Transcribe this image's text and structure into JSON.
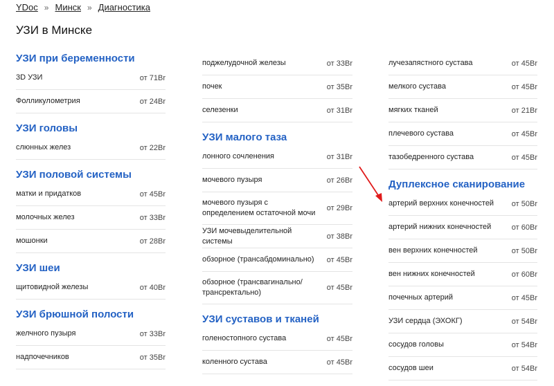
{
  "breadcrumb": {
    "items": [
      "YDoc",
      "Минск",
      "Диагностика"
    ],
    "separator": "»"
  },
  "page_title": "УЗИ в Минске",
  "columns": [
    {
      "blocks": [
        {
          "type": "header",
          "text": "УЗИ при беременности",
          "h": 24,
          "gap_before": 0
        },
        {
          "type": "row",
          "name": "3D УЗИ",
          "price": "от 71Br",
          "h": 34
        },
        {
          "type": "row",
          "name": "Фолликулометрия",
          "price": "от 24Br",
          "h": 34
        },
        {
          "type": "header",
          "text": "УЗИ головы",
          "h": 24,
          "gap_before": 9
        },
        {
          "type": "row",
          "name": "слюнных желез",
          "price": "от 22Br",
          "h": 34
        },
        {
          "type": "header",
          "text": "УЗИ половой системы",
          "h": 24,
          "gap_before": 9
        },
        {
          "type": "row",
          "name": "матки и придатков",
          "price": "от 45Br",
          "h": 34
        },
        {
          "type": "row",
          "name": "молочных желез",
          "price": "от 33Br",
          "h": 34
        },
        {
          "type": "row",
          "name": "мошонки",
          "price": "от 28Br",
          "h": 34
        },
        {
          "type": "header",
          "text": "УЗИ шеи",
          "h": 24,
          "gap_before": 9
        },
        {
          "type": "row",
          "name": "щитовидной железы",
          "price": "от 40Br",
          "h": 34
        },
        {
          "type": "header",
          "text": "УЗИ брюшной полости",
          "h": 24,
          "gap_before": 9
        },
        {
          "type": "row",
          "name": "желчного пузыря",
          "price": "от 33Br",
          "h": 34
        },
        {
          "type": "row",
          "name": "надпочечников",
          "price": "от 35Br",
          "h": 34
        }
      ]
    },
    {
      "blocks": [
        {
          "type": "row",
          "name": "поджелудочной железы",
          "price": "от 33Br",
          "h": 34
        },
        {
          "type": "row",
          "name": "почек",
          "price": "от 35Br",
          "h": 34
        },
        {
          "type": "row",
          "name": "селезенки",
          "price": "от 31Br",
          "h": 34
        },
        {
          "type": "header",
          "text": "УЗИ малого таза",
          "h": 24,
          "gap_before": 9
        },
        {
          "type": "row",
          "name": "лонного сочленения",
          "price": "от 31Br",
          "h": 34
        },
        {
          "type": "row",
          "name": "мочевого пузыря",
          "price": "от 26Br",
          "h": 34
        },
        {
          "type": "row",
          "name": "мочевого пузыря с определением остаточной мочи",
          "price": "от 29Br",
          "h": 47
        },
        {
          "type": "row",
          "name": "УЗИ мочевыделительной системы",
          "price": "от 38Br",
          "h": 34
        },
        {
          "type": "row",
          "name": "обзорное (трансабдоминально)",
          "price": "от 45Br",
          "h": 34
        },
        {
          "type": "row",
          "name": "обзорное (трансвагинально/трансректально)",
          "price": "от 45Br",
          "h": 47
        },
        {
          "type": "header",
          "text": "УЗИ суставов и тканей",
          "h": 24,
          "gap_before": 9
        },
        {
          "type": "row",
          "name": "голеностопного сустава",
          "price": "от 45Br",
          "h": 34
        },
        {
          "type": "row",
          "name": "коленного сустава",
          "price": "от 45Br",
          "h": 34
        }
      ]
    },
    {
      "blocks": [
        {
          "type": "row",
          "name": "лучезапястного сустава",
          "price": "от 45Br",
          "h": 34
        },
        {
          "type": "row",
          "name": "мелкого сустава",
          "price": "от 45Br",
          "h": 34
        },
        {
          "type": "row",
          "name": "мягких тканей",
          "price": "от 21Br",
          "h": 34
        },
        {
          "type": "row",
          "name": "плечевого сустава",
          "price": "от 45Br",
          "h": 34
        },
        {
          "type": "row",
          "name": "тазобедренного сустава",
          "price": "от 45Br",
          "h": 34
        },
        {
          "type": "header",
          "text": "Дуплексное сканирование",
          "h": 24,
          "gap_before": 9
        },
        {
          "type": "row",
          "name": "артерий верхних конечностей",
          "price": "от 50Br",
          "h": 34
        },
        {
          "type": "row",
          "name": "артерий нижних конечностей",
          "price": "от 60Br",
          "h": 34
        },
        {
          "type": "row",
          "name": "вен верхних конечностей",
          "price": "от 50Br",
          "h": 34
        },
        {
          "type": "row",
          "name": "вен нижних конечностей",
          "price": "от 60Br",
          "h": 34
        },
        {
          "type": "row",
          "name": "почечных артерий",
          "price": "от 45Br",
          "h": 34
        },
        {
          "type": "row",
          "name": "УЗИ сердца (ЭХОКГ)",
          "price": "от 54Br",
          "h": 34
        },
        {
          "type": "row",
          "name": "сосудов головы",
          "price": "от 54Br",
          "h": 34
        },
        {
          "type": "row",
          "name": "сосудов шеи",
          "price": "от 54Br",
          "h": 34
        }
      ]
    }
  ],
  "colors": {
    "accent": "#2462c4",
    "annotation_arrow": "#e01b1b",
    "divider": "#e4e4e4"
  }
}
